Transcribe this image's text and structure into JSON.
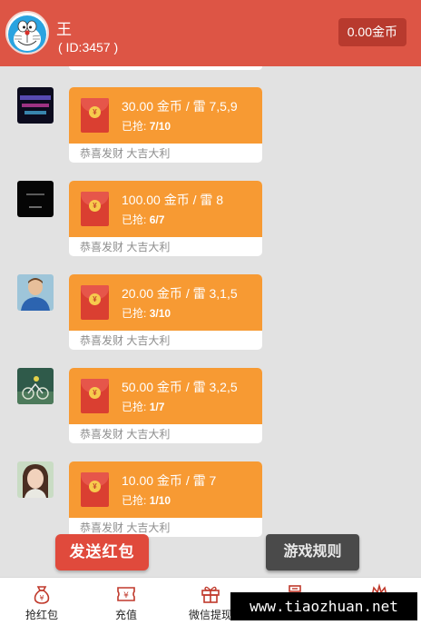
{
  "header": {
    "user_name": "王",
    "user_id": "( ID:3457 )",
    "balance": "0.00金币",
    "avatar_icon": "doraemon-avatar"
  },
  "messages": [
    {
      "avatar": "dark-neon-text-thumbnail",
      "title": "30.00 金币 / 雷 7,5,9",
      "progress_label": "已抢:",
      "progress_value": "7/10",
      "footer": "恭喜发财 大吉大利"
    },
    {
      "avatar": "dark-thumbnail",
      "title": "100.00 金币 / 雷 8",
      "progress_label": "已抢:",
      "progress_value": "6/7",
      "footer": "恭喜发财 大吉大利"
    },
    {
      "avatar": "person-portrait-thumbnail",
      "title": "20.00 金币 / 雷 3,1,5",
      "progress_label": "已抢:",
      "progress_value": "3/10",
      "footer": "恭喜发财 大吉大利"
    },
    {
      "avatar": "bicycle-race-thumbnail",
      "title": "50.00 金币 / 雷 3,2,5",
      "progress_label": "已抢:",
      "progress_value": "1/7",
      "footer": "恭喜发财 大吉大利"
    },
    {
      "avatar": "girl-portrait-thumbnail",
      "title": "10.00 金币 / 雷 7",
      "progress_label": "已抢:",
      "progress_value": "1/10",
      "footer": "恭喜发财 大吉大利"
    }
  ],
  "actions": {
    "send_label": "发送红包",
    "rules_label": "游戏规则"
  },
  "nav": [
    {
      "label": "抢红包",
      "icon": "money-bag-icon"
    },
    {
      "label": "充值",
      "icon": "yuan-ticket-icon"
    },
    {
      "label": "微信提现",
      "icon": "gift-icon"
    },
    {
      "label": "",
      "icon": "user-card-icon"
    },
    {
      "label": "",
      "icon": "crown-icon"
    }
  ],
  "watermark": "www.tiaozhuan.net",
  "colors": {
    "header_bg": "#dd5545",
    "packet_orange": "#f79a33",
    "envelope_red": "#da3f31",
    "send_button": "#e04a3c",
    "rules_button": "#4a4a4a"
  }
}
